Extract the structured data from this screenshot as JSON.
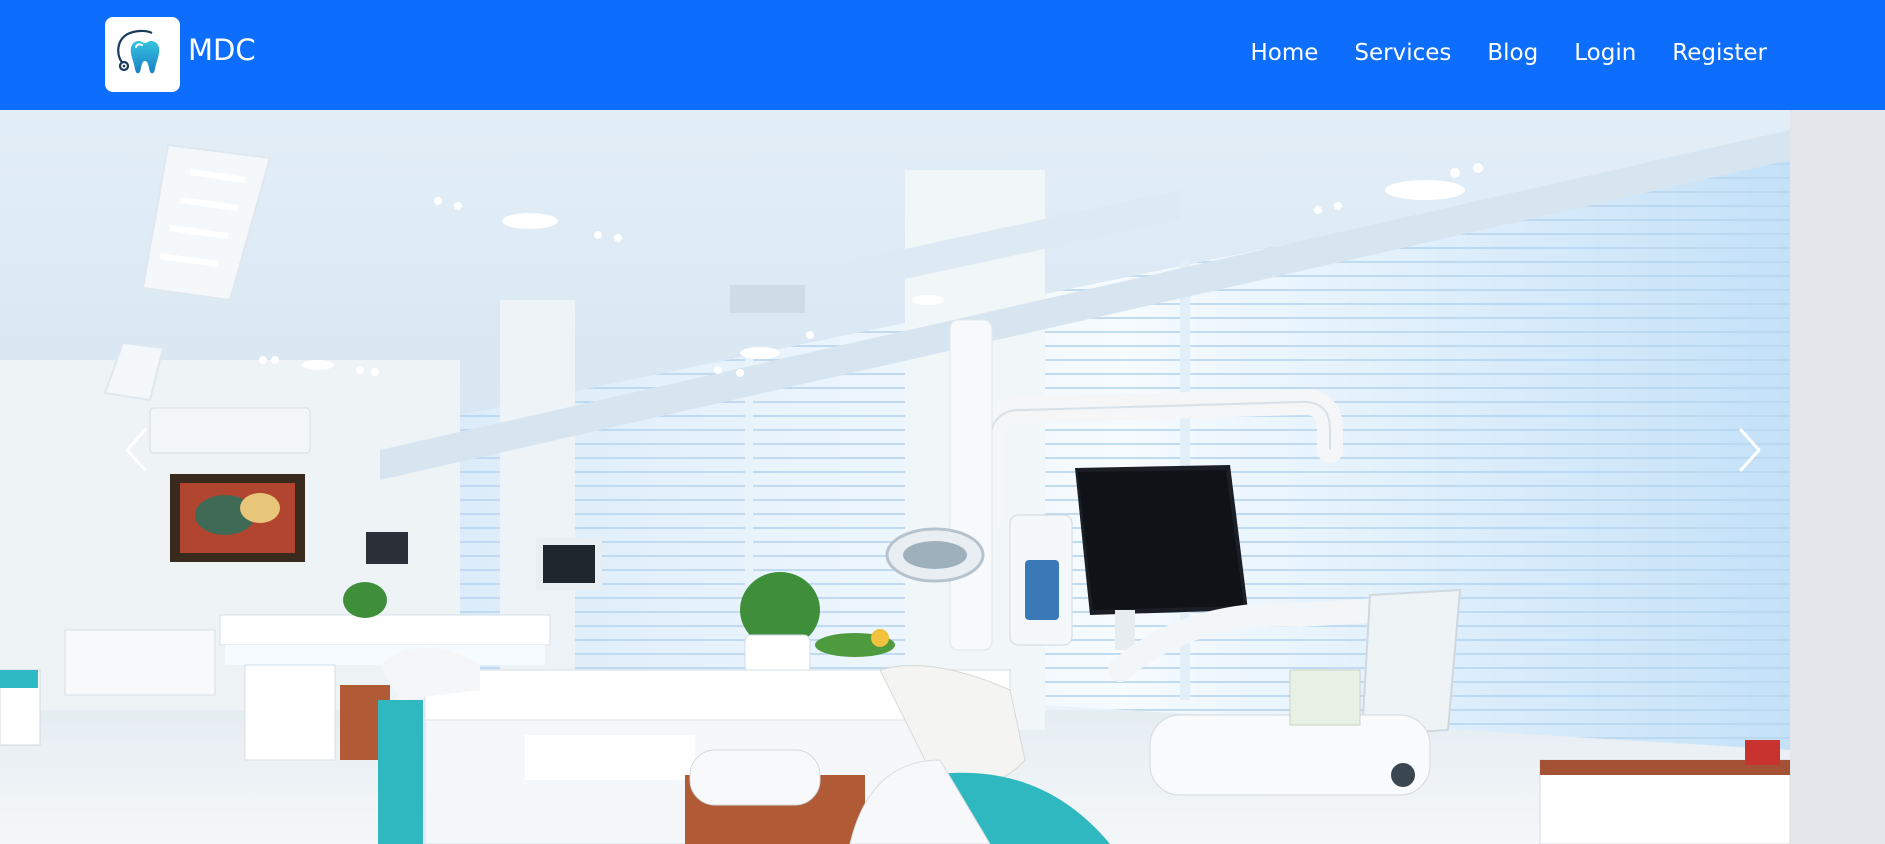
{
  "brand": {
    "name": "MDC",
    "accent": "#0d6efd",
    "logo_icon": "tooth-stethoscope-icon"
  },
  "nav": {
    "items": [
      {
        "label": "Home"
      },
      {
        "label": "Services"
      },
      {
        "label": "Blog"
      },
      {
        "label": "Login"
      },
      {
        "label": "Register"
      }
    ]
  },
  "carousel": {
    "slide_image": "dental-clinic-photo",
    "prev_icon": "chevron-left-icon",
    "next_icon": "chevron-right-icon"
  }
}
